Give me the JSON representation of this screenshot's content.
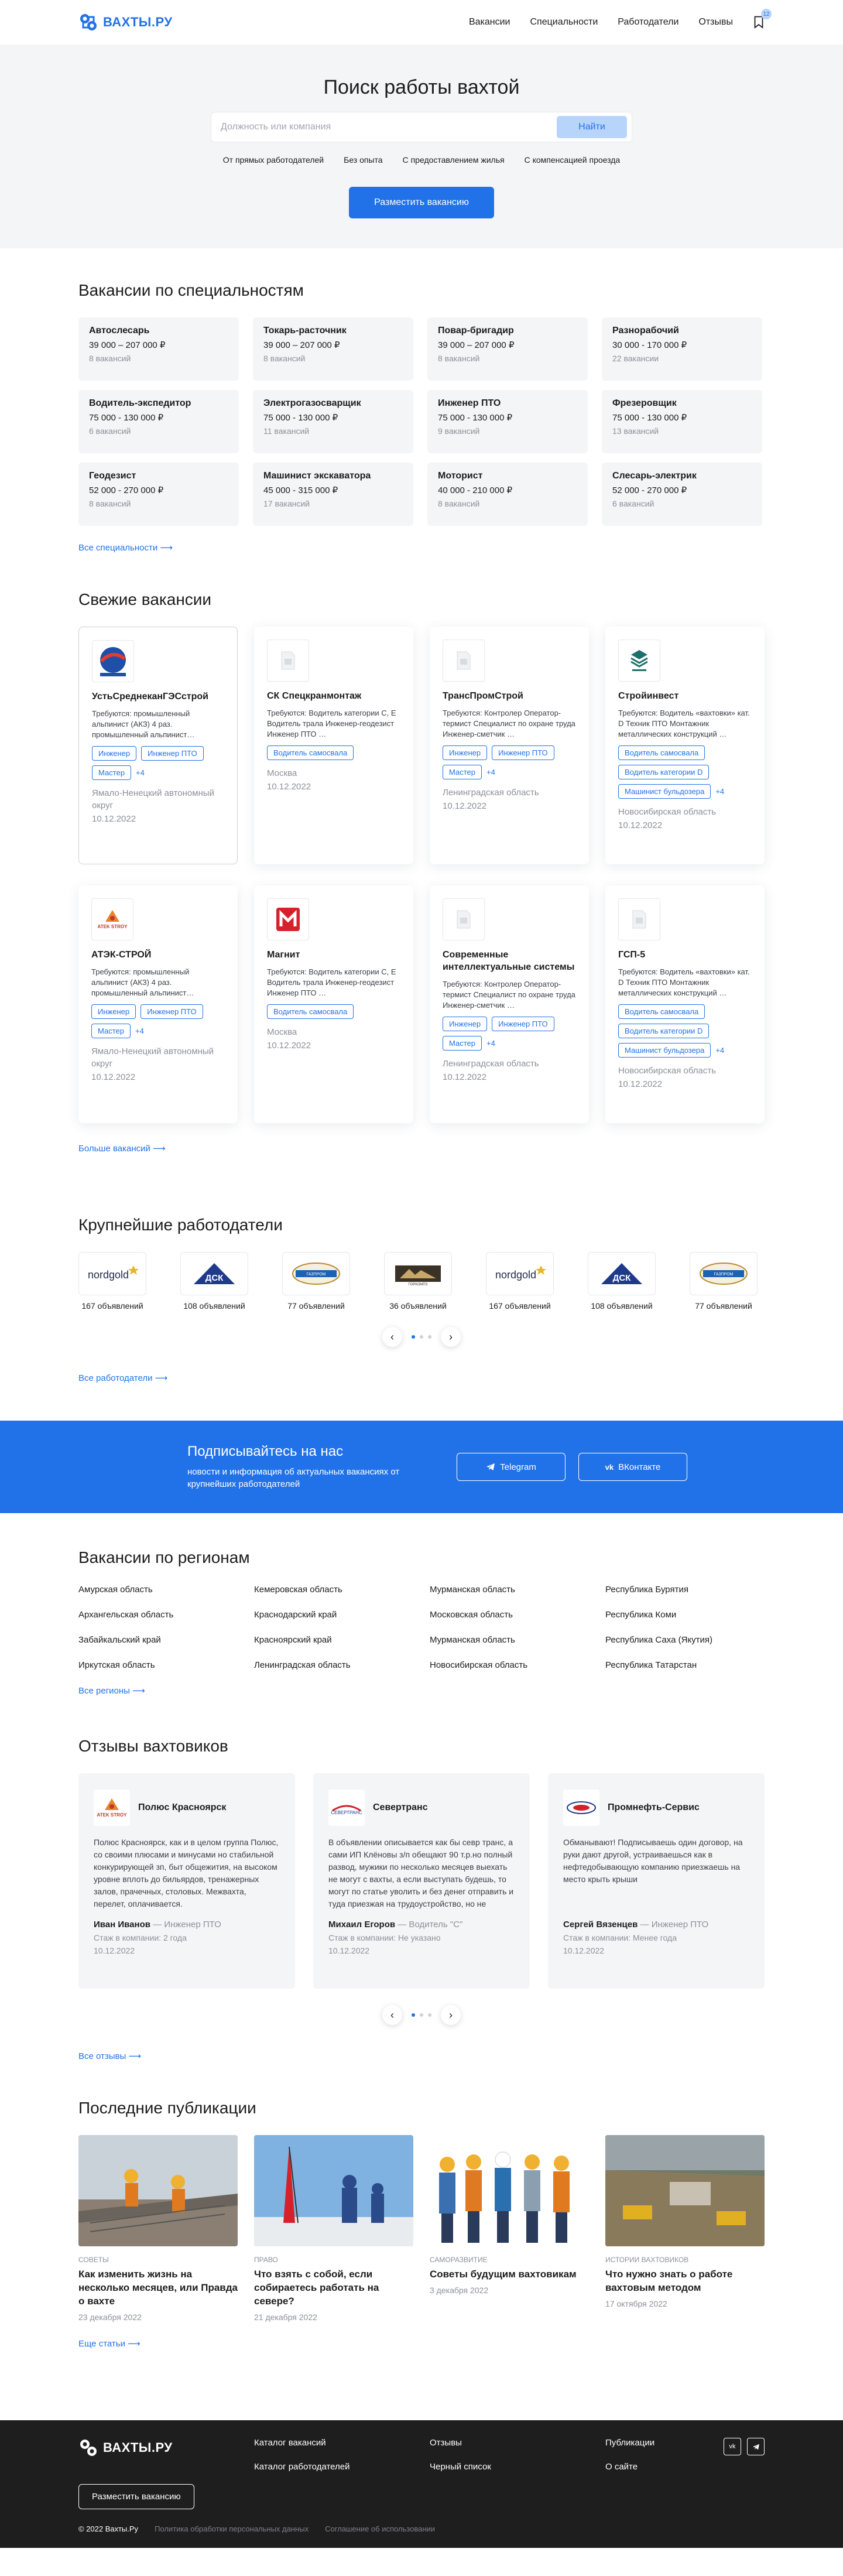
{
  "header": {
    "logo": "ВАХТЫ.РУ",
    "nav": [
      "Вакансии",
      "Специальности",
      "Работодатели",
      "Отзывы"
    ],
    "bookmark_count": "12"
  },
  "hero": {
    "title": "Поиск работы вахтой",
    "search_placeholder": "Должность или компания",
    "search_button": "Найти",
    "filters": [
      "От прямых работодателей",
      "Без опыта",
      "С предоставлением жилья",
      "С компенсацией проезда"
    ],
    "post_button": "Разместить вакансию"
  },
  "specialties": {
    "title": "Вакансии по специальностям",
    "items": [
      {
        "name": "Автослесарь",
        "range": "39 000 – 207 000 ₽",
        "count": "8 вакансий"
      },
      {
        "name": "Токарь-расточник",
        "range": "39 000 – 207 000 ₽",
        "count": "8 вакансий"
      },
      {
        "name": "Повар-бригадир",
        "range": "39 000 – 207 000 ₽",
        "count": "8 вакансий"
      },
      {
        "name": "Разнорабочий",
        "range": "30 000 - 170 000 ₽",
        "count": "22 вакансии"
      },
      {
        "name": "Водитель-экспедитор",
        "range": "75 000 - 130 000 ₽",
        "count": "6 вакансий"
      },
      {
        "name": "Электрогазосварщик",
        "range": "75 000 - 130 000 ₽",
        "count": "11 вакансий"
      },
      {
        "name": "Инженер ПТО",
        "range": "75 000 - 130 000 ₽",
        "count": "9 вакансий"
      },
      {
        "name": "Фрезеровщик",
        "range": "75 000 - 130 000 ₽",
        "count": "13 вакансий"
      },
      {
        "name": "Геодезист",
        "range": "52 000 - 270 000 ₽",
        "count": "8 вакансий"
      },
      {
        "name": "Машинист экскаватора",
        "range": "45 000 - 315 000 ₽",
        "count": "17 вакансий"
      },
      {
        "name": "Моторист",
        "range": "40 000 - 210 000 ₽",
        "count": "8 вакансий"
      },
      {
        "name": "Слесарь-электрик",
        "range": "52 000 - 270 000 ₽",
        "count": "6 вакансий"
      }
    ],
    "more": "Все специальности ⟶"
  },
  "fresh": {
    "title": "Свежие вакансии",
    "items": [
      {
        "company": "УстьСреднеканГЭСстрой",
        "req": "Требуются: промышленный альпинист (АКЗ) 4 раз. промышленный альпинист…",
        "tags": [
          "Инженер",
          "Инженер ПТО",
          "Мастер"
        ],
        "more": "+4",
        "loc": "Ямало-Ненецкий автономный округ",
        "date": "10.12.2022"
      },
      {
        "company": "СК Спецкранмонтаж",
        "req": "Требуются: Водитель категории С, Е Водитель трала Инженер-геодезист Инженер ПТО …",
        "tags": [
          "Водитель самосвала"
        ],
        "more": "",
        "loc": "Москва",
        "date": "10.12.2022"
      },
      {
        "company": "ТрансПромСтрой",
        "req": "Требуются: Контролер Оператор-термист Специалист по охране труда Инженер-сметчик …",
        "tags": [
          "Инженер",
          "Инженер ПТО",
          "Мастер"
        ],
        "more": "+4",
        "loc": "Ленинградская область",
        "date": "10.12.2022"
      },
      {
        "company": "Стройинвест",
        "req": "Требуются: Водитель «вахтовки» кат. D Техник ПТО Монтажник металлических конструкций …",
        "tags": [
          "Водитель самосвала",
          "Водитель категории D",
          "Машинист бульдозера"
        ],
        "more": "+4",
        "loc": "Новосибирская область",
        "date": "10.12.2022"
      },
      {
        "company": "АТЭК-СТРОЙ",
        "req": "Требуются: промышленный альпинист (АКЗ) 4 раз. промышленный альпинист…",
        "tags": [
          "Инженер",
          "Инженер ПТО",
          "Мастер"
        ],
        "more": "+4",
        "loc": "Ямало-Ненецкий автономный округ",
        "date": "10.12.2022"
      },
      {
        "company": "Магнит",
        "req": "Требуются: Водитель категории С, Е Водитель трала Инженер-геодезист Инженер ПТО …",
        "tags": [
          "Водитель самосвала"
        ],
        "more": "",
        "loc": "Москва",
        "date": "10.12.2022"
      },
      {
        "company": "Современные интеллектуальные системы",
        "req": "Требуются: Контролер Оператор-термист Специалист по охране труда Инженер-сметчик …",
        "tags": [
          "Инженер",
          "Инженер ПТО",
          "Мастер"
        ],
        "more": "+4",
        "loc": "Ленинградская область",
        "date": "10.12.2022"
      },
      {
        "company": "ГСП-5",
        "req": "Требуются: Водитель «вахтовки» кат. D Техник ПТО Монтажник металлических конструкций …",
        "tags": [
          "Водитель самосвала",
          "Водитель категории D",
          "Машинист бульдозера"
        ],
        "more": "+4",
        "loc": "Новосибирская область",
        "date": "10.12.2022"
      }
    ],
    "more": "Больше вакансий ⟶"
  },
  "employers": {
    "title": "Крупнейшие работодатели",
    "items": [
      {
        "logo": "nordgold",
        "count": "167 объявлений"
      },
      {
        "logo": "dsk",
        "count": "108 объявлений"
      },
      {
        "logo": "gazprom",
        "count": "77 объявлений"
      },
      {
        "logo": "gorkomps",
        "count": "36 объявлений"
      },
      {
        "logo": "nordgold",
        "count": "167 объявлений"
      },
      {
        "logo": "dsk",
        "count": "108 объявлений"
      },
      {
        "logo": "gazprom",
        "count": "77 объявлений"
      }
    ],
    "more": "Все работодатели ⟶"
  },
  "subscribe": {
    "title": "Подписывайтесь на нас",
    "text": "новости и информация об актуальных вакансиях от крупнейших работодателей",
    "telegram": "Telegram",
    "vk": "ВКонтакте"
  },
  "regions": {
    "title": "Вакансии по регионам",
    "items": [
      "Амурская область",
      "Кемеровская область",
      "Мурманская область",
      "Республика Бурятия",
      "Архангельская область",
      "Краснодарский край",
      "Московская область",
      "Республика Коми",
      "Забайкальский край",
      "Красноярский край",
      "Мурманская область",
      "Республика Саха (Якутия)",
      "Иркутская область",
      "Ленинградская область",
      "Новосибирская область",
      "Республика Татарстан"
    ],
    "more": "Все регионы ⟶"
  },
  "reviews": {
    "title": "Отзывы вахтовиков",
    "items": [
      {
        "company": "Полюс Красноярск",
        "text": "Полюс Красноярск, как и в целом группа Полюс, со своими плюсами и минусами но стабильной конкурирующей зп, быт общежития, на высоком уровне вплоть до бильярдов, тренажерных залов, прачечных, столовых. Межвахта, перелет, оплачивается.",
        "author": "Иван Иванов",
        "role": "— Инженер ПТО",
        "exp": "Стаж в компании: 2 года",
        "date": "10.12.2022"
      },
      {
        "company": "Севертранс",
        "text": "В объявлении описывается как бы севр транс, а сами ИП Клёновы з/п обещают 90 т.р.но полный развод, мужики по несколько месяцев выехать не могут с вахты, а если выступать будешь, то могут по статье уволить и без денег отправить и туда приезжая на трудоустройство, но не устроился т.к. работа…",
        "author": "Михаил Егоров",
        "role": "— Водитель \"С\"",
        "exp": "Стаж в компании: Не указано",
        "date": "10.12.2022"
      },
      {
        "company": "Промнефть-Сервис",
        "text": "Обманывают! Подписываешь один договор, на руки дают другой, устраиваешься как в нефтедобывающую компанию приезжаешь на место крыть крыши",
        "author": "Сергей Вязенцев",
        "role": "— Инженер ПТО",
        "exp": "Стаж в компании: Менее года",
        "date": "10.12.2022"
      }
    ],
    "more": "Все отзывы ⟶"
  },
  "publications": {
    "title": "Последние публикации",
    "items": [
      {
        "cat": "Советы",
        "title": "Как изменить жизнь на несколько месяцев, или Правда о вахте",
        "date": "23 декабря 2022"
      },
      {
        "cat": "Право",
        "title": "Что взять с собой, если собираетесь работать на севере?",
        "date": "21 декабря 2022"
      },
      {
        "cat": "Саморазвитие",
        "title": "Советы будущим вахтовикам",
        "date": "3 декабря 2022"
      },
      {
        "cat": "Истории вахтовиков",
        "title": "Что нужно знать о работе вахтовым методом",
        "date": "17 октября 2022"
      }
    ],
    "more": "Еще статьи ⟶"
  },
  "footer": {
    "logo": "ВАХТЫ.РУ",
    "post_button": "Разместить вакансию",
    "col1": [
      "Каталог вакансий",
      "Каталог работодателей"
    ],
    "col2": [
      "Отзывы",
      "Черный список"
    ],
    "col3": [
      "Публикации",
      "О сайте"
    ],
    "copyright": "© 2022 Вахты.Ру",
    "privacy": "Политика обработки персональных данных",
    "terms": "Соглашение об использовании"
  },
  "colors": {
    "accent": "#2172e8",
    "light_bg": "#f4f5f7",
    "footer_bg": "#1e1e1e"
  }
}
